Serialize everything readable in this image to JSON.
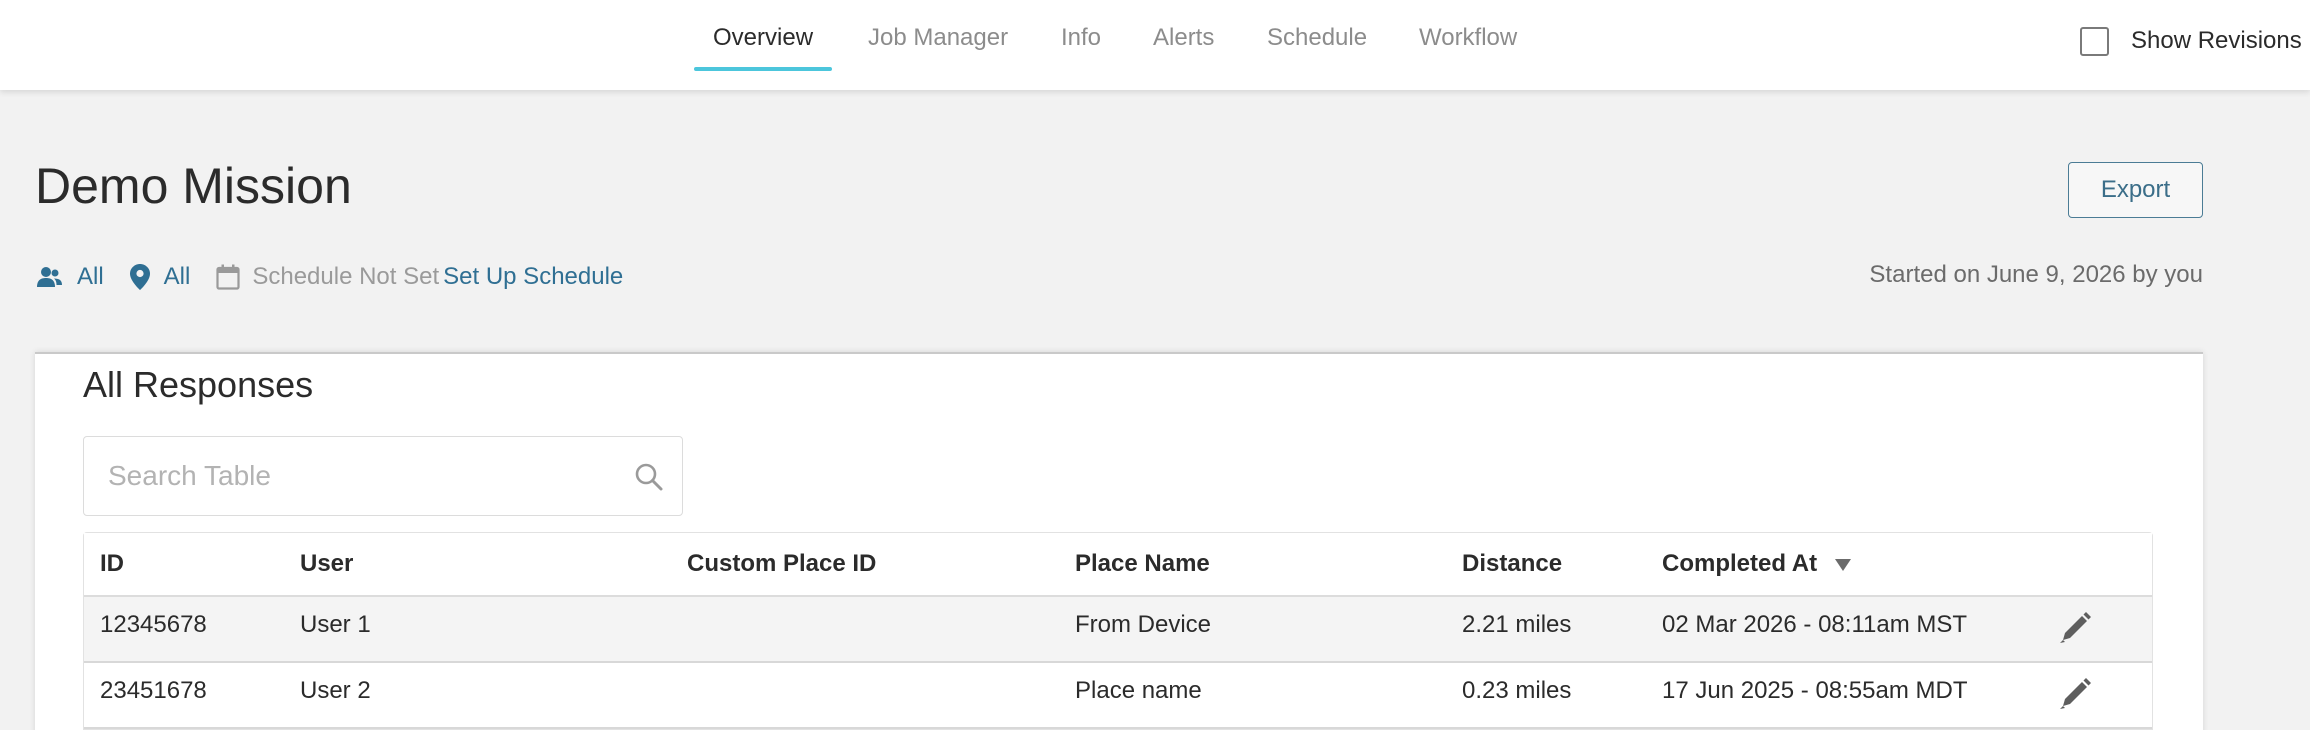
{
  "nav": {
    "tabs": [
      {
        "label": "Overview",
        "active": true
      },
      {
        "label": "Job Manager",
        "active": false
      },
      {
        "label": "Info",
        "active": false
      },
      {
        "label": "Alerts",
        "active": false
      },
      {
        "label": "Schedule",
        "active": false
      },
      {
        "label": "Workflow",
        "active": false
      }
    ],
    "show_revisions": {
      "label": "Show Revisions",
      "checked": false
    }
  },
  "header": {
    "title": "Demo Mission",
    "export_label": "Export",
    "filters": {
      "users": "All",
      "places": "All",
      "schedule_status": "Schedule Not Set",
      "schedule_link": "Set Up Schedule"
    },
    "started": "Started on June 9, 2026 by you"
  },
  "responses": {
    "title": "All Responses",
    "search_placeholder": "Search Table",
    "columns": [
      "ID",
      "User",
      "Custom Place ID",
      "Place Name",
      "Distance",
      "Completed At"
    ],
    "sort": {
      "column": "Completed At",
      "direction": "desc"
    },
    "rows": [
      {
        "id": "12345678",
        "user": "User 1",
        "custom_place_id": "",
        "place_name": "From Device",
        "distance": "2.21 miles",
        "completed_at": "02 Mar 2026 - 08:11am MST"
      },
      {
        "id": "23451678",
        "user": "User 2",
        "custom_place_id": "",
        "place_name": "Place name",
        "distance": "0.23 miles",
        "completed_at": "17 Jun 2025 - 08:55am MDT"
      }
    ]
  },
  "colors": {
    "accent": "#4cc6dc",
    "link": "#2f6f93",
    "background": "#f2f2f2"
  },
  "icons": [
    "users-icon",
    "map-pin-icon",
    "calendar-icon",
    "search-icon",
    "sort-desc-icon",
    "pencil-icon"
  ]
}
